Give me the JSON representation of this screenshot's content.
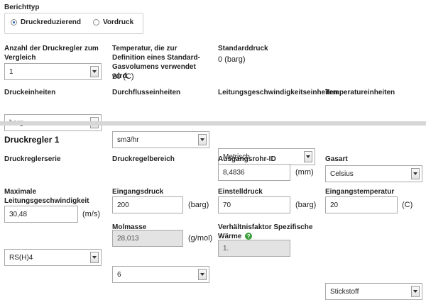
{
  "report_type": {
    "label": "Berichttyp",
    "options": [
      {
        "label": "Druckreduzierend",
        "selected": true
      },
      {
        "label": "Vordruck",
        "selected": false
      }
    ]
  },
  "general": {
    "regulator_count": {
      "label": "Anzahl der Druckregler zum Vergleich",
      "value": "1"
    },
    "temperature": {
      "label": "Temperatur, die zur Definition eines Standard-Gasvolumens verwendet wird.",
      "value": "20 (C)"
    },
    "standard_pressure": {
      "label": "Standarddruck",
      "value": "0 (barg)"
    },
    "pressure_units": {
      "label": "Druckeinheiten",
      "value": "barg"
    },
    "flow_units": {
      "label": "Durchflusseinheiten",
      "value": "sm3/hr"
    },
    "velocity_units": {
      "label": "Leitungsgeschwindigkeitseinheiten",
      "value": "Metrisch"
    },
    "temperature_units": {
      "label": "Temperatureinheiten",
      "value": "Celsius"
    }
  },
  "regulator": {
    "title": "Druckregler 1",
    "series": {
      "label": "Druckreglerserie",
      "value": "RS(H)4"
    },
    "range": {
      "label": "Druckregelbereich",
      "value": "6"
    },
    "outlet_id": {
      "label": "Ausgangsrohr-ID",
      "value": "8,4836",
      "unit": "(mm)"
    },
    "gas_type": {
      "label": "Gasart",
      "value": "Stickstoff"
    },
    "max_velocity": {
      "label": "Maximale Leitungsgeschwindigkeit",
      "value": "30,48",
      "unit": "(m/s)"
    },
    "inlet_pressure": {
      "label": "Eingangsdruck",
      "value": "200",
      "unit": "(barg)"
    },
    "set_pressure": {
      "label": "Einstelldruck",
      "value": "70",
      "unit": "(barg)"
    },
    "inlet_temperature": {
      "label": "Eingangstemperatur",
      "value": "20",
      "unit": "(C)"
    },
    "molar_mass": {
      "label": "Molmasse",
      "value": "28,013",
      "unit": "(g/mol)"
    },
    "specific_heat_ratio": {
      "label": "Verhältnisfaktor Spezifische Wärme",
      "value": "1.",
      "help": "?"
    }
  },
  "colors": {
    "help_badge": "#3aa03a",
    "divider": "#d6d6d6",
    "readonly_bg": "#e3e3e3"
  }
}
